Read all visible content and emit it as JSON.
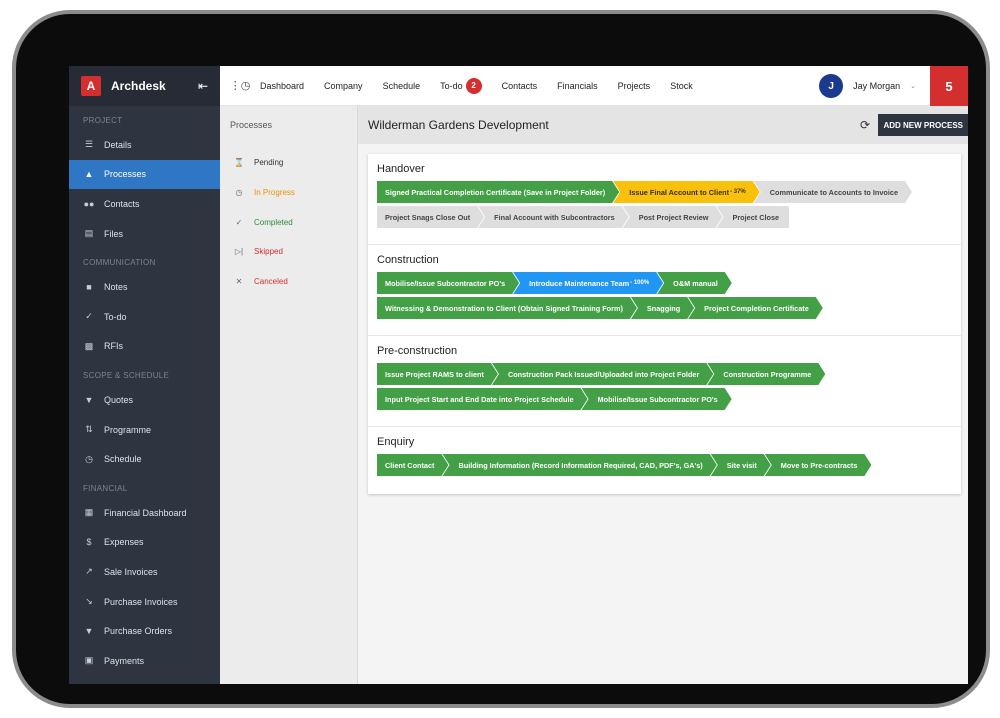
{
  "sidebar": {
    "brand_letter": "A",
    "brand_name": "Archdesk",
    "collapse_icon": "«",
    "sections": {
      "project": "PROJECT",
      "communication": "COMMUNICATION",
      "scope": "SCOPE & SCHEDULE",
      "financial": "FINANCIAL"
    },
    "items": {
      "details": "Details",
      "processes": "Processes",
      "contacts": "Contacts",
      "files": "Files",
      "notes": "Notes",
      "todo": "To-do",
      "rfis": "RFIs",
      "quotes": "Quotes",
      "programme": "Programme",
      "schedule": "Schedule",
      "financial_dashboard": "Financial Dashboard",
      "expenses": "Expenses",
      "sale_invoices": "Sale Invoices",
      "purchase_invoices": "Purchase Invoices",
      "purchase_orders": "Purchase Orders",
      "payments": "Payments"
    },
    "active_color": "#2f76c4"
  },
  "topbar": {
    "nav": {
      "dashboard": "Dashboard",
      "company": "Company",
      "schedule": "Schedule",
      "todo": "To-do",
      "todo_count": "2",
      "contacts": "Contacts",
      "financials": "Financials",
      "projects": "Projects",
      "stock": "Stock"
    },
    "user": {
      "initial": "J",
      "name": "Jay Morgan"
    },
    "notifications": "5"
  },
  "processes_panel": {
    "title": "Processes",
    "filters": {
      "pending": "Pending",
      "in_progress": "In Progress",
      "completed": "Completed",
      "skipped": "Skipped",
      "canceled": "Canceled"
    }
  },
  "detail": {
    "title": "Wilderman Gardens Development",
    "add_button": "ADD NEW PROCESS",
    "stages": [
      {
        "name": "Handover",
        "rows": [
          [
            {
              "label": "Signed Practical Completion Certificate (Save in Project Folder)",
              "status": "green"
            },
            {
              "label": "Issue Final Account to Client",
              "progress": " - 37%",
              "status": "yellow"
            },
            {
              "label": "Communicate to Accounts to Invoice",
              "status": "gray"
            }
          ],
          [
            {
              "label": "Project Snags Close Out",
              "status": "gray"
            },
            {
              "label": "Final Account with Subcontractors",
              "status": "gray"
            },
            {
              "label": "Post Project Review",
              "status": "gray"
            },
            {
              "label": "Project Close",
              "status": "gray"
            }
          ]
        ]
      },
      {
        "name": "Construction",
        "rows": [
          [
            {
              "label": "Mobilise/Issue Subcontractor PO's",
              "status": "green"
            },
            {
              "label": "Introduce Maintenance Team",
              "progress": " - 100%",
              "status": "blue"
            },
            {
              "label": "O&M manual",
              "status": "green"
            }
          ],
          [
            {
              "label": "Witnessing & Demonstration to Client (Obtain Signed Training Form)",
              "status": "green"
            },
            {
              "label": "Snagging",
              "status": "green"
            },
            {
              "label": "Project Completion Certificate",
              "status": "green"
            }
          ]
        ]
      },
      {
        "name": "Pre-construction",
        "rows": [
          [
            {
              "label": "Issue Project RAMS to client",
              "status": "green"
            },
            {
              "label": "Construction Pack Issued/Uploaded into Project Folder",
              "status": "green"
            },
            {
              "label": "Construction Programme",
              "status": "green"
            }
          ],
          [
            {
              "label": "Input Project Start and End Date into Project Schedule",
              "status": "green"
            },
            {
              "label": "Mobilise/Issue Subcontractor PO's",
              "status": "green"
            }
          ]
        ]
      },
      {
        "name": "Enquiry",
        "rows": [
          [
            {
              "label": "Client Contact",
              "status": "green"
            },
            {
              "label": "Building Information (Record Information Required, CAD, PDF's, GA's)",
              "status": "green"
            },
            {
              "label": "Site visit",
              "status": "green"
            },
            {
              "label": "Move to Pre-contracts",
              "status": "green"
            }
          ]
        ]
      }
    ]
  }
}
